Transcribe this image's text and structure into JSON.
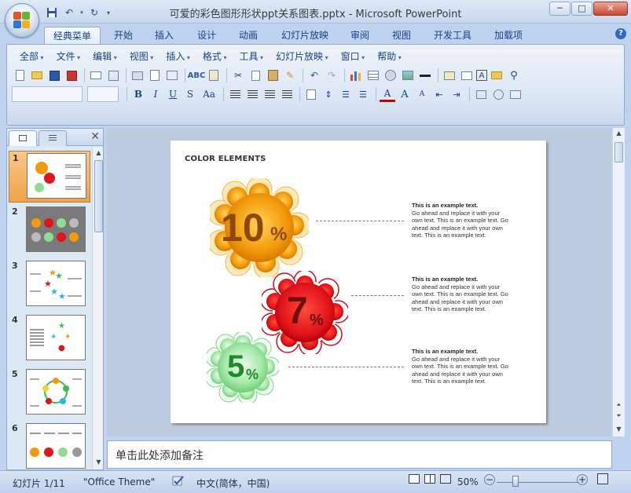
{
  "window": {
    "title": "可爱的彩色图形形状ppt关系图表.pptx - Microsoft PowerPoint",
    "controls": [
      "─",
      "□",
      "✕"
    ]
  },
  "ribbon_tabs": [
    {
      "label": "经典菜单",
      "active": true
    },
    {
      "label": "开始"
    },
    {
      "label": "插入"
    },
    {
      "label": "设计"
    },
    {
      "label": "动画"
    },
    {
      "label": "幻灯片放映"
    },
    {
      "label": "审阅"
    },
    {
      "label": "视图"
    },
    {
      "label": "开发工具"
    },
    {
      "label": "加载项"
    }
  ],
  "classic_menu": [
    "全部",
    "文件",
    "编辑",
    "视图",
    "插入",
    "格式",
    "工具",
    "幻灯片放映",
    "窗口",
    "帮助"
  ],
  "font_buttons": {
    "bold": "B",
    "italic": "I",
    "underline": "U",
    "strike": "S",
    "case": "Aa",
    "font_color": "A",
    "grow": "A",
    "shrink": "A"
  },
  "slide_numbers": [
    "1",
    "2",
    "3",
    "4",
    "5",
    "6"
  ],
  "slide": {
    "title": "COLOR ELEMENTS",
    "items": [
      {
        "number": "10",
        "unit": "%",
        "color": "#f39a0a",
        "heading": "This is an example text.",
        "body": "Go ahead and replace it with your own text. This is an example text. Go ahead and replace it with your own text. This is an example text."
      },
      {
        "number": "7",
        "unit": "%",
        "color": "#e0141b",
        "heading": "This is an example text.",
        "body": "Go ahead and replace it with your own text. This is an example text. Go ahead and replace it with your own text. This is an example text."
      },
      {
        "number": "5",
        "unit": "%",
        "color": "#8fdc95",
        "heading": "This is an example text.",
        "body": "Go ahead and replace it with your own text. This is an example text. Go ahead and replace it with your own text. This is an example text."
      }
    ]
  },
  "notes": {
    "placeholder": "单击此处添加备注"
  },
  "status": {
    "slide_counter": "幻灯片 1/11",
    "theme": "\"Office Theme\"",
    "language": "中文(简体，中国)",
    "zoom": "50%",
    "zoom_minus": "−",
    "zoom_plus": "+"
  }
}
